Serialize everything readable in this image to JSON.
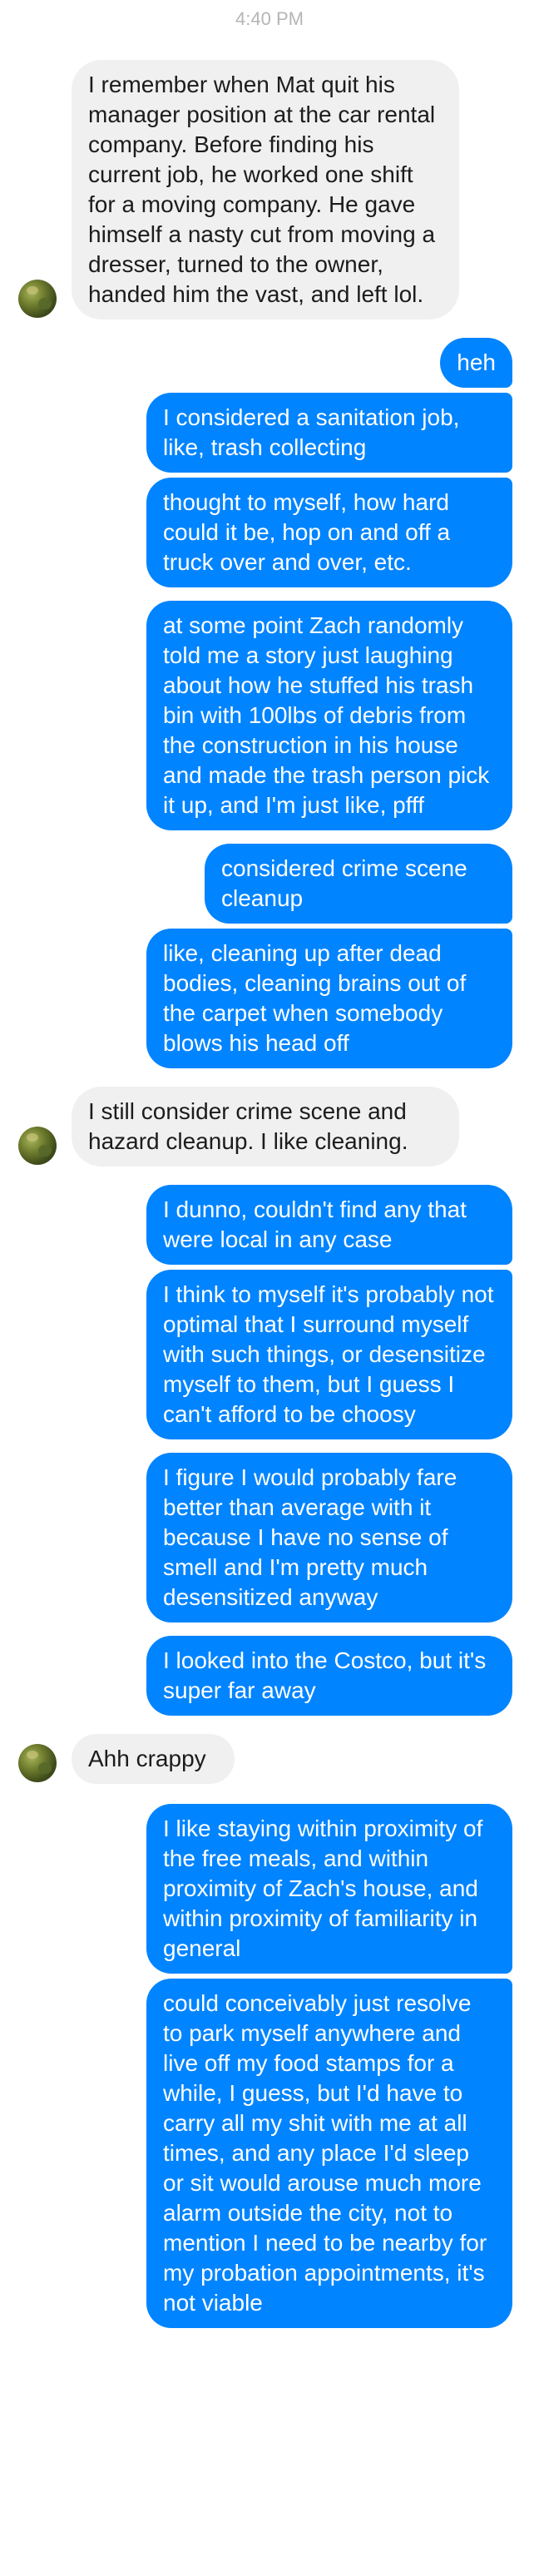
{
  "header": {
    "time": "4:40 PM"
  },
  "messages": [
    {
      "dir": "in",
      "text": "I remember when Mat quit his manager position at the car rental company. Before finding his current job, he worked one shift for a moving company. He gave himself a nasty cut from moving a dresser, turned to the owner, handed him the vast, and left lol."
    },
    {
      "dir": "out",
      "text": "heh"
    },
    {
      "dir": "out",
      "text": "I considered a sanitation job, like, trash collecting"
    },
    {
      "dir": "out",
      "text": "thought to myself, how hard could it be, hop on and off a truck over and over, etc."
    },
    {
      "dir": "out",
      "text": "at some point Zach randomly told me a story just laughing about how he stuffed his trash bin with 100lbs of debris from the construction in his house and made the trash person pick it up, and I'm just like, pfff"
    },
    {
      "dir": "out",
      "text": "considered crime scene cleanup"
    },
    {
      "dir": "out",
      "text": "like, cleaning up after dead bodies, cleaning brains out of the carpet when somebody blows his head off"
    },
    {
      "dir": "in",
      "text": "I still consider crime scene and hazard cleanup. I like cleaning."
    },
    {
      "dir": "out",
      "text": "I dunno, couldn't find any that were local in any case"
    },
    {
      "dir": "out",
      "text": "I think to myself it's probably not optimal that I surround myself with such things, or desensitize myself to them, but I guess I can't afford to be choosy"
    },
    {
      "dir": "out",
      "text": "I figure I would probably fare better than average with it because I have no sense of smell and I'm pretty much desensitized anyway"
    },
    {
      "dir": "out",
      "text": "I looked into the Costco, but it's super far away"
    },
    {
      "dir": "in",
      "text": "Ahh crappy"
    },
    {
      "dir": "out",
      "text": "I like staying within proximity of the free meals, and within proximity of Zach's house, and within proximity of familiarity in general"
    },
    {
      "dir": "out",
      "text": "could conceivably just resolve to park myself anywhere and live off my food stamps for a while, I guess, but I'd have to carry all my shit with me at all times, and any place I'd sleep or sit would arouse much more alarm outside the city, not to mention I need to be nearby for my probation appointments, it's not viable"
    }
  ]
}
